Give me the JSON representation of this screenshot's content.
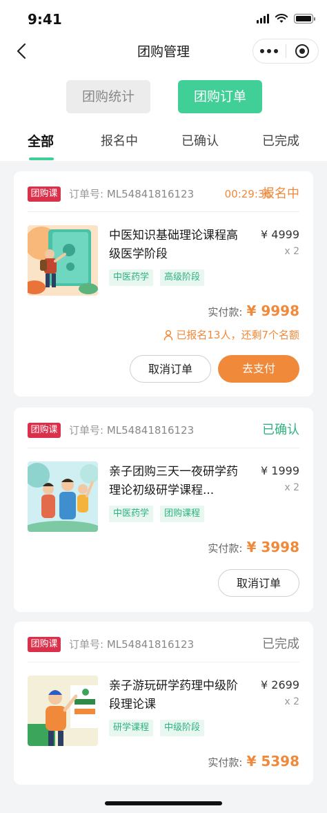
{
  "status_bar": {
    "time": "9:41"
  },
  "nav": {
    "title": "团购管理"
  },
  "segments": {
    "stats_label": "团购统计",
    "orders_label": "团购订单"
  },
  "tabs": [
    {
      "label": "全部",
      "active": true
    },
    {
      "label": "报名中",
      "active": false
    },
    {
      "label": "已确认",
      "active": false
    },
    {
      "label": "已完成",
      "active": false
    }
  ],
  "orders": [
    {
      "badge": "团购课",
      "order_label": "订单号:",
      "order_no": "ML54841816123",
      "countdown": "00:29:36",
      "status": "报名中",
      "title": "中医知识基础理论课程高级医学阶段",
      "price": "¥ 4999",
      "qty": "x 2",
      "tags": [
        "中医药学",
        "高级阶段"
      ],
      "paid_label": "实付款:",
      "paid_amount": "¥ 9998",
      "hint": "已报名13人，还剩7个名额",
      "buttons": {
        "cancel": "取消订单",
        "pay": "去支付"
      }
    },
    {
      "badge": "团购课",
      "order_label": "订单号:",
      "order_no": "ML54841816123",
      "status": "已确认",
      "title": "亲子团购三天一夜研学药理论初级研学课程...",
      "price": "¥ 1999",
      "qty": "x 2",
      "tags": [
        "中医药学",
        "团购课程"
      ],
      "paid_label": "实付款:",
      "paid_amount": "¥ 3998",
      "buttons": {
        "cancel": "取消订单"
      }
    },
    {
      "badge": "团购课",
      "order_label": "订单号:",
      "order_no": "ML54841816123",
      "status": "已完成",
      "title": "亲子游玩研学药理中级阶段理论课",
      "price": "¥ 2699",
      "qty": "x 2",
      "tags": [
        "研学课程",
        "中级阶段"
      ],
      "paid_label": "实付款:",
      "paid_amount": "¥ 5398"
    }
  ],
  "colors": {
    "accent": "#3fcf97",
    "orange": "#f0893a",
    "badge": "#d9304b",
    "confirmed": "#2db27f",
    "completed": "#777777"
  },
  "icons": [
    "back-arrow-icon",
    "more-dots-icon",
    "target-icon",
    "person-icon",
    "signal-icon",
    "wifi-icon",
    "battery-icon"
  ]
}
